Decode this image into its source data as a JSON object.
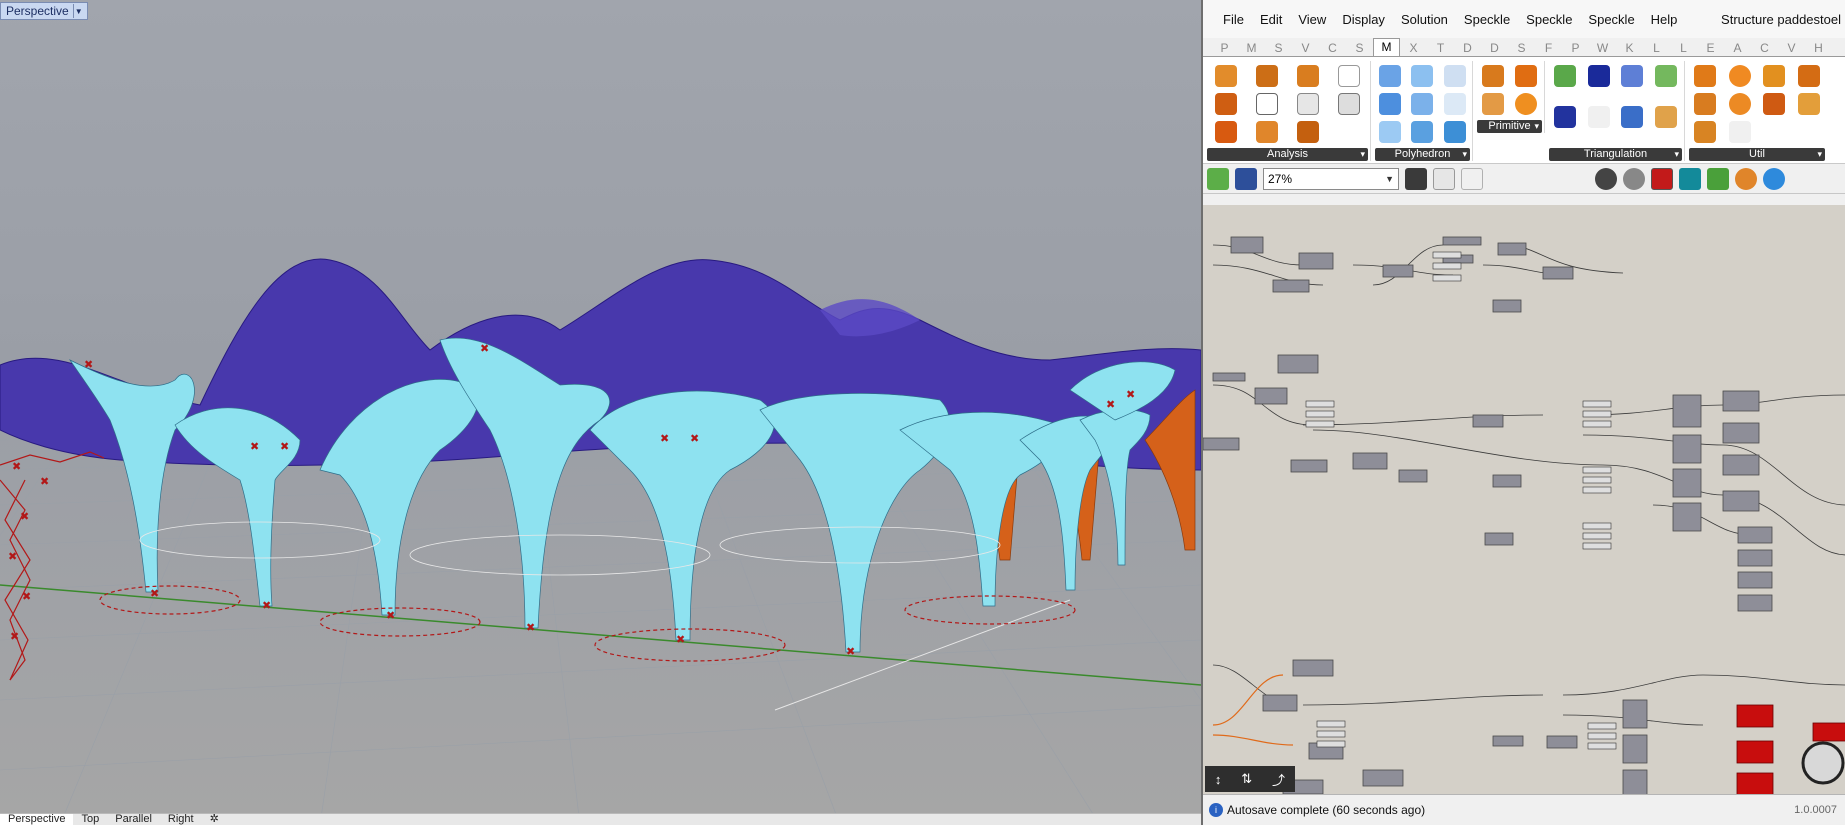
{
  "viewport": {
    "name": "Perspective",
    "dropdown_icon": "caret-down",
    "tabs": [
      "Perspective",
      "Top",
      "Parallel",
      "Right",
      "✲"
    ]
  },
  "grasshopper": {
    "menu": [
      "File",
      "Edit",
      "View",
      "Display",
      "Solution",
      "Speckle",
      "Speckle",
      "Speckle",
      "Help"
    ],
    "document_title": "Structure paddestoel",
    "tabs": [
      "P",
      "M",
      "S",
      "V",
      "C",
      "S",
      "M",
      "X",
      "T",
      "D",
      "D",
      "S",
      "F",
      "P",
      "W",
      "K",
      "L",
      "L",
      "E",
      "A",
      "C",
      "V",
      "H"
    ],
    "active_tab": "M",
    "groups": [
      {
        "name": "Analysis",
        "icon_count": 11
      },
      {
        "name": "Polyhedron",
        "icon_count": 9
      },
      {
        "name": "Primitive",
        "icon_count": 4
      },
      {
        "name": "Triangulation",
        "icon_count": 8
      },
      {
        "name": "Util",
        "icon_count": 10
      }
    ],
    "zoom": "27%",
    "status": "Autosave complete (60 seconds ago)",
    "version": "1.0.0007"
  },
  "colors": {
    "shell": "#8ee2f0",
    "roof": "#3320a8",
    "support": "#e06a1a",
    "marker": "#b21818",
    "canvas": "#d4d0c8",
    "component": "#8e8e98",
    "error_component": "#c80d0d"
  }
}
